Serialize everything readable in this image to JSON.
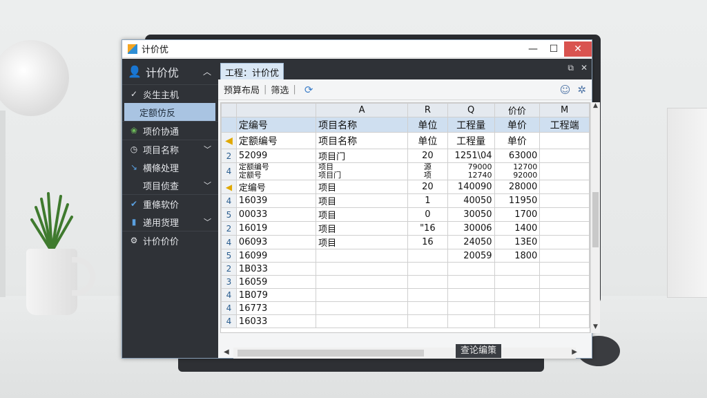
{
  "window": {
    "title": "计价优"
  },
  "sidebar": {
    "header": "计价优",
    "items": [
      {
        "label": "炎生主机",
        "icon": "check-icon"
      },
      {
        "label": "定额仿反",
        "icon": ""
      },
      {
        "label": "项价协通",
        "icon": "leaf-icon"
      },
      {
        "label": "项目名称",
        "icon": "clock-icon"
      },
      {
        "label": "横條处理",
        "icon": "pin-icon"
      },
      {
        "label": "项目侦查",
        "icon": ""
      },
      {
        "label": "重條软价",
        "icon": "check-icon"
      },
      {
        "label": "递用货理",
        "icon": "chart-icon"
      },
      {
        "label": "计价价价",
        "icon": "gear-icon"
      }
    ]
  },
  "tab": {
    "label": "工程：计价优"
  },
  "toolbar": {
    "item1": "预算布局",
    "item2": "筛选"
  },
  "grid": {
    "col_letters": [
      "",
      "A",
      "R",
      "Q",
      "价价",
      "M"
    ],
    "header_row": [
      "定编号",
      "项目名称",
      "单位",
      "工程量",
      "单价",
      "工程端"
    ],
    "header_row2": [
      "定额编号",
      "项目名称",
      "单位",
      "工程量",
      "单价",
      ""
    ],
    "rows": [
      {
        "rn": "2",
        "cells": [
          "52099",
          "项目门",
          "20",
          "1251\\04",
          "63000",
          ""
        ]
      },
      {
        "rn": "4",
        "cells": [
          "定额编号\n定额号",
          "项目\n项目门",
          "源\n项",
          "79000\n12740",
          "12700\n92000",
          ""
        ]
      },
      {
        "rn": "◀",
        "cells": [
          "定编号",
          "项目",
          "20",
          "140090",
          "28000",
          ""
        ]
      },
      {
        "rn": "4",
        "cells": [
          "16039",
          "项目",
          "1",
          "40050",
          "11950",
          ""
        ]
      },
      {
        "rn": "5",
        "cells": [
          "00033",
          "项目",
          "0",
          "30050",
          "1700",
          ""
        ]
      },
      {
        "rn": "2",
        "cells": [
          "16019",
          "项目",
          "\"16",
          "30006",
          "1400",
          ""
        ]
      },
      {
        "rn": "4",
        "cells": [
          "06093",
          "项目",
          "16",
          "24050",
          "13E0",
          ""
        ]
      },
      {
        "rn": "5",
        "cells": [
          "16099",
          "",
          "",
          "20059",
          "1800",
          ""
        ]
      },
      {
        "rn": "2",
        "cells": [
          "1B033",
          "",
          "",
          "",
          "",
          ""
        ]
      },
      {
        "rn": "3",
        "cells": [
          "16059",
          "",
          "",
          "",
          "",
          ""
        ]
      },
      {
        "rn": "4",
        "cells": [
          "1B079",
          "",
          "",
          "",
          "",
          ""
        ]
      },
      {
        "rn": "4",
        "cells": [
          "16773",
          "",
          "",
          "",
          "",
          ""
        ]
      },
      {
        "rn": "4",
        "cells": [
          "16033",
          "",
          "",
          "",
          "",
          ""
        ]
      }
    ]
  },
  "status_tip": "查论编策"
}
